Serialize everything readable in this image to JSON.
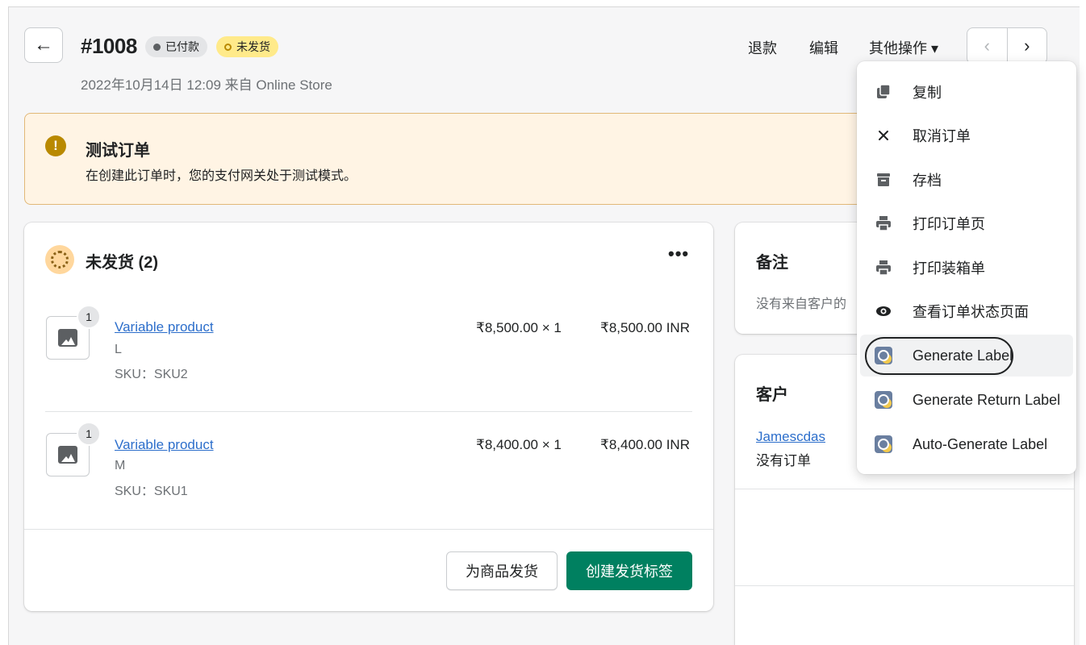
{
  "header": {
    "back_icon": "←",
    "order_number": "#1008",
    "badge_paid": "已付款",
    "badge_unfulfilled": "未发货",
    "subtitle": "2022年10月14日 12:09 来自 Online Store",
    "actions": {
      "refund": "退款",
      "edit": "编辑",
      "more": "其他操作 ▾"
    },
    "pager": {
      "prev": "‹",
      "next": "›"
    }
  },
  "banner": {
    "icon": "!",
    "title": "测试订单",
    "text": "在创建此订单时，您的支付网关处于测试模式。"
  },
  "fulfillment": {
    "title": "未发货 (2)",
    "more_icon": "•••",
    "items": [
      {
        "qty": "1",
        "name": "Variable product",
        "variant": "L",
        "sku": "SKU：SKU2",
        "unit_price": "₹8,500.00 × 1",
        "total": "₹8,500.00 INR"
      },
      {
        "qty": "1",
        "name": "Variable product",
        "variant": "M",
        "sku": "SKU：SKU1",
        "unit_price": "₹8,400.00 × 1",
        "total": "₹8,400.00 INR"
      }
    ],
    "btn_fulfill": "为商品发货",
    "btn_create_label": "创建发货标签"
  },
  "notes": {
    "title": "备注",
    "text": "没有来自客户的"
  },
  "customer": {
    "title": "客户",
    "name": "Jamescdas",
    "orders": "没有订单"
  },
  "dropdown": {
    "items": [
      {
        "icon": "duplicate-icon",
        "label": "复制"
      },
      {
        "icon": "close-icon",
        "label": "取消订单"
      },
      {
        "icon": "archive-icon",
        "label": "存档"
      },
      {
        "icon": "print-icon",
        "label": "打印订单页"
      },
      {
        "icon": "print-icon",
        "label": "打印装箱单"
      },
      {
        "icon": "eye-icon",
        "label": "查看订单状态页面"
      },
      {
        "icon": "app-icon",
        "label": "Generate Label"
      },
      {
        "icon": "app-icon",
        "label": "Generate Return Label"
      },
      {
        "icon": "app-icon",
        "label": "Auto-Generate Label"
      }
    ]
  },
  "colors": {
    "primary": "#008060",
    "link": "#2c6ecb",
    "warning_bg": "#fff4e4",
    "badge_yellow": "#ffea8a"
  }
}
